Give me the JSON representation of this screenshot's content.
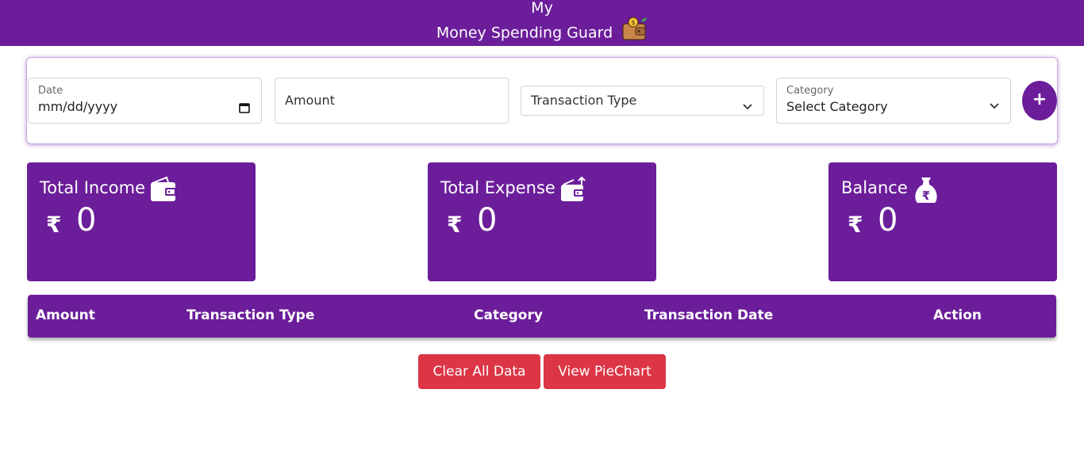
{
  "header": {
    "title_line1": "My",
    "title_line2": "Money Spending Guard",
    "logo_icon": "wallet-money-icon"
  },
  "form": {
    "date": {
      "label": "Date",
      "value": "mm/dd/yyyy"
    },
    "amount": {
      "placeholder": "Amount"
    },
    "transaction_type": {
      "selected": "Transaction Type"
    },
    "category": {
      "label": "Category",
      "selected": "Select Category"
    },
    "add_button_label": "+"
  },
  "stats": {
    "income": {
      "title": "Total Income",
      "currency": "₹",
      "value": "0",
      "icon": "wallet-icon"
    },
    "expense": {
      "title": "Total Expense",
      "currency": "₹",
      "value": "0",
      "icon": "wallet-out-icon"
    },
    "balance": {
      "title": "Balance",
      "currency": "₹",
      "value": "0",
      "icon": "money-bag-icon"
    }
  },
  "table": {
    "columns": [
      "Amount",
      "Transaction Type",
      "Category",
      "Transaction Date",
      "Action"
    ]
  },
  "buttons": {
    "clear": "Clear All Data",
    "piechart": "View PieChart"
  },
  "colors": {
    "primary": "#6b1d9a",
    "danger": "#dc3545"
  }
}
